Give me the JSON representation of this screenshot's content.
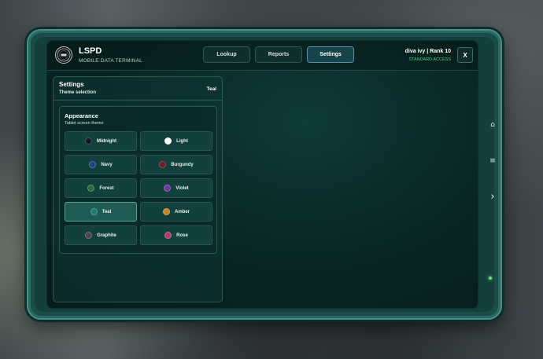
{
  "app": {
    "name": "LSPD",
    "subtitle": "MOBILE DATA TERMINAL"
  },
  "tabs": [
    {
      "label": "Lookup",
      "active": false
    },
    {
      "label": "Reports",
      "active": false
    },
    {
      "label": "Settings",
      "active": true
    }
  ],
  "user": {
    "display": "diva ivy | Rank 10",
    "access": "STANDARD ACCESS"
  },
  "close_label": "X",
  "settings": {
    "title": "Settings",
    "subtitle": "Theme selection",
    "current": "Teal",
    "appearance": {
      "title": "Appearance",
      "subtitle": "Tablet screen theme",
      "themes": [
        {
          "label": "Midnight",
          "color": "#14162a"
        },
        {
          "label": "Light",
          "color": "#ffffff"
        },
        {
          "label": "Navy",
          "color": "#1f3f86"
        },
        {
          "label": "Burgundy",
          "color": "#6a1a2a"
        },
        {
          "label": "Forest",
          "color": "#2f6b3a"
        },
        {
          "label": "Violet",
          "color": "#6a3a9e"
        },
        {
          "label": "Teal",
          "color": "#1e7a6f"
        },
        {
          "label": "Amber",
          "color": "#c4842a"
        },
        {
          "label": "Graphite",
          "color": "#4a4550"
        },
        {
          "label": "Rose",
          "color": "#b23a6a"
        }
      ],
      "selected": "Teal"
    }
  },
  "side_buttons": [
    {
      "icon": "home-icon",
      "glyph": "⌂"
    },
    {
      "icon": "menu-icon",
      "glyph": "≡"
    },
    {
      "icon": "chevron-right-icon",
      "glyph": "›"
    }
  ],
  "colors": {
    "accent": "#5a8fb0",
    "status_led": "#6fe36f",
    "access_text": "#59c98a"
  }
}
